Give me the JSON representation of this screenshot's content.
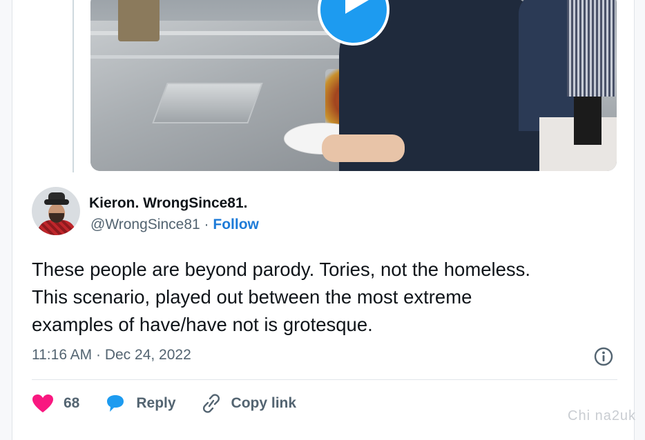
{
  "author": {
    "name": "Kieron. WrongSince81.",
    "handle": "@WrongSince81",
    "separator": "·",
    "follow_label": "Follow"
  },
  "tweet": {
    "lines": [
      "These people are beyond parody. Tories, not the homeless.",
      "This scenario, played out between the most extreme",
      "examples of have/have not is grotesque."
    ],
    "timestamp": "11:16 AM · Dec 24, 2022"
  },
  "actions": {
    "like_count": "68",
    "reply_label": "Reply",
    "copy_link_label": "Copy link"
  },
  "icons": {
    "play": "play-icon",
    "info": "info-icon",
    "heart": "heart-icon",
    "reply": "reply-bubble-icon",
    "link": "link-icon"
  },
  "colors": {
    "accent": "#1d9bf0",
    "follow": "#1d7bd8",
    "like": "#f91880",
    "muted": "#536471",
    "text": "#0f1419"
  },
  "watermark": "Chi na2uk"
}
